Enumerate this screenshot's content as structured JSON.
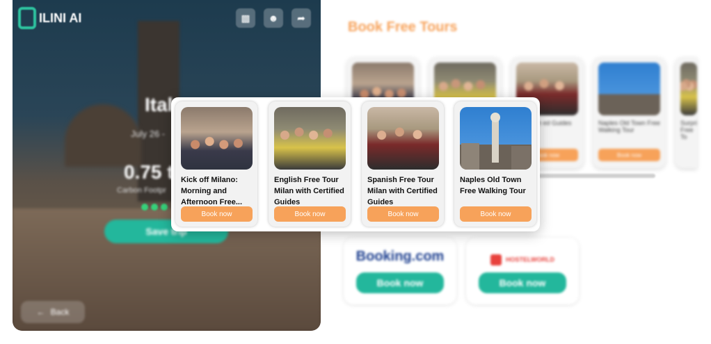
{
  "hero": {
    "brand": "ILINI AI",
    "city": "Ital",
    "dates": "July 26 -",
    "carbon_value": "0.75 t",
    "carbon_label": "Carbon Footpr",
    "save_label": "Save trip",
    "back_label": "Back",
    "icons": [
      "car-icon",
      "user-icon",
      "share-icon"
    ]
  },
  "section": {
    "heading": "Book Free Tours"
  },
  "background_cards": [
    {
      "title": "",
      "button": ""
    },
    {
      "title": "",
      "button": ""
    },
    {
      "title": "Tour with ed Guides",
      "button": "Book now"
    },
    {
      "title": "Naples Old Town Free Walking Tour",
      "button": "Book now"
    },
    {
      "title": "Surpri Free To",
      "button": ""
    }
  ],
  "tours": [
    {
      "title": "Kick off Milano: Morning and Afternoon Free...",
      "button": "Book now"
    },
    {
      "title": "English Free Tour Milan with Certified Guides",
      "button": "Book now"
    },
    {
      "title": "Spanish Free Tour Milan with Certified Guides",
      "button": "Book now"
    },
    {
      "title": "Naples Old Town Free Walking Tour",
      "button": "Book now"
    }
  ],
  "partners": [
    {
      "name": "Booking.com",
      "button": "Book now",
      "color": "#1d3f8f"
    },
    {
      "name": "HOSTELWORLD",
      "button": "Book now",
      "color": "#e8413c"
    }
  ],
  "colors": {
    "accent_orange": "#f7a25a",
    "accent_teal": "#23b79c"
  }
}
